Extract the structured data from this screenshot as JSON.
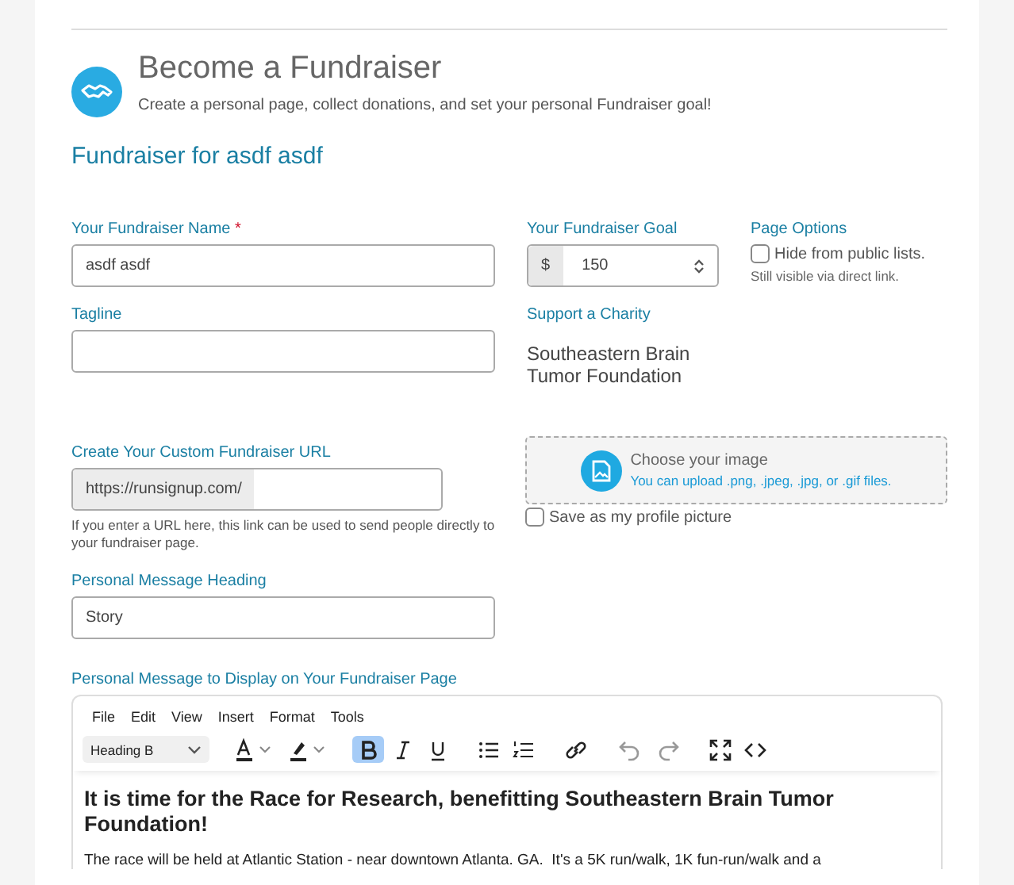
{
  "header": {
    "title": "Become a Fundraiser",
    "subtitle": "Create a personal page, collect donations, and set your personal Fundraiser goal!"
  },
  "section_title": "Fundraiser for asdf asdf",
  "name_field": {
    "label": "Your Fundraiser Name",
    "required_mark": "*",
    "value": "asdf asdf"
  },
  "goal_field": {
    "label": "Your Fundraiser Goal",
    "prefix": "$",
    "value": "150"
  },
  "page_options": {
    "label": "Page Options",
    "option": "Hide from public lists.",
    "checked": false,
    "note": "Still visible via direct link."
  },
  "tagline_field": {
    "label": "Tagline"
  },
  "charity": {
    "label": "Support a Charity",
    "name": "Southeastern Brain Tumor Foundation"
  },
  "url_field": {
    "label": "Create Your Custom Fundraiser URL",
    "prefix": "https://runsignup.com/",
    "help": "If you enter a URL here, this link can be used to send people directly to your fundraiser page."
  },
  "image_upload": {
    "title": "Choose your image",
    "hint": "You can upload .png, .jpeg, .jpg, or .gif files.",
    "profile_option": "Save as my profile picture",
    "profile_checked": false
  },
  "heading_field": {
    "label": "Personal Message Heading",
    "value": "Story"
  },
  "editor": {
    "label": "Personal Message to Display on Your Fundraiser Page",
    "menu": [
      "File",
      "Edit",
      "View",
      "Insert",
      "Format",
      "Tools"
    ],
    "block_format": "Heading B",
    "tools": [
      {
        "kind": "text-color",
        "selected": false
      },
      {
        "kind": "highlight",
        "selected": false
      },
      {
        "kind": "bold",
        "selected": true
      },
      {
        "kind": "italic",
        "selected": false
      },
      {
        "kind": "underline",
        "selected": false
      },
      {
        "kind": "bullet-list",
        "selected": false
      },
      {
        "kind": "numbered-list",
        "selected": false
      },
      {
        "kind": "link",
        "selected": false
      },
      {
        "kind": "undo",
        "selected": false
      },
      {
        "kind": "redo",
        "selected": false
      },
      {
        "kind": "fullscreen",
        "selected": false
      },
      {
        "kind": "code",
        "selected": false
      }
    ],
    "heading": "It is time for the Race for Research, benefitting Southeastern Brain Tumor Foundation!",
    "body": "The race will be held at Atlantic Station - near downtown Atlanta. GA.  It's a 5K run/walk, 1K fun-run/walk and a"
  }
}
